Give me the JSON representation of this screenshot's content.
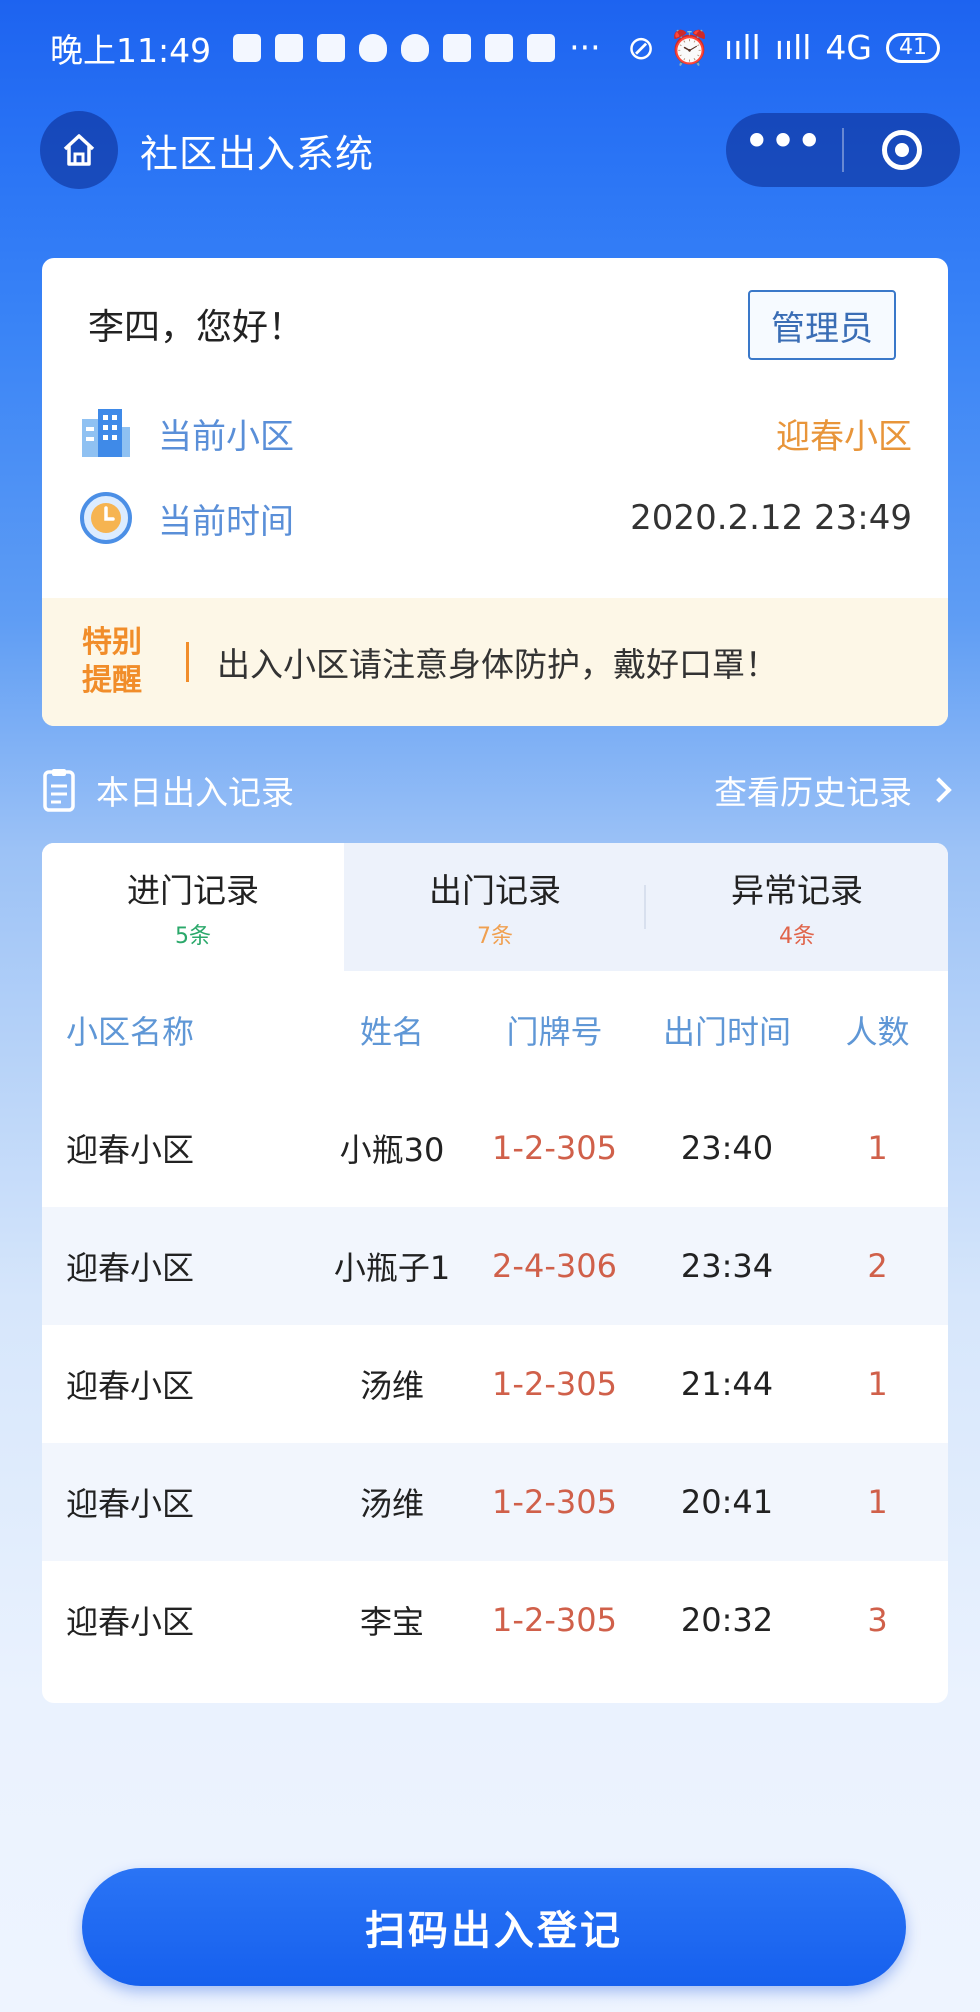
{
  "status_bar": {
    "time": "晚上11:49",
    "more": "···",
    "network": "4G",
    "signal_a": "ııll",
    "signal_b": "ııll",
    "battery": "41"
  },
  "nav": {
    "title": "社区出入系统",
    "more_label": "•••"
  },
  "info": {
    "greeting": "李四，您好！",
    "role_button": "管理员",
    "community_label": "当前小区",
    "community_value": "迎春小区",
    "time_label": "当前时间",
    "time_value": "2020.2.12 23:49",
    "notice_tag": "特别提醒",
    "notice_text": "出入小区请注意身体防护，戴好口罩！"
  },
  "records": {
    "title": "本日出入记录",
    "history_link": "查看历史记录",
    "tabs": [
      {
        "label": "进门记录",
        "count": "5条",
        "color": "#2aa86a"
      },
      {
        "label": "出门记录",
        "count": "7条",
        "color": "#f0a050"
      },
      {
        "label": "异常记录",
        "count": "4条",
        "color": "#e0644a"
      }
    ],
    "columns": [
      "小区名称",
      "姓名",
      "门牌号",
      "出门时间",
      "人数"
    ],
    "rows": [
      [
        "迎春小区",
        "小瓶30",
        "1-2-305",
        "23:40",
        "1"
      ],
      [
        "迎春小区",
        "小瓶子1",
        "2-4-306",
        "23:34",
        "2"
      ],
      [
        "迎春小区",
        "汤维",
        "1-2-305",
        "21:44",
        "1"
      ],
      [
        "迎春小区",
        "汤维",
        "1-2-305",
        "20:41",
        "1"
      ],
      [
        "迎春小区",
        "李宝",
        "1-2-305",
        "20:32",
        "3"
      ]
    ]
  },
  "scan_button": "扫码出入登记",
  "colors": {
    "primary": "#1d63f0",
    "accent_orange": "#e8953a",
    "label_blue": "#5a8fd8",
    "value_red": "#d0604a"
  }
}
